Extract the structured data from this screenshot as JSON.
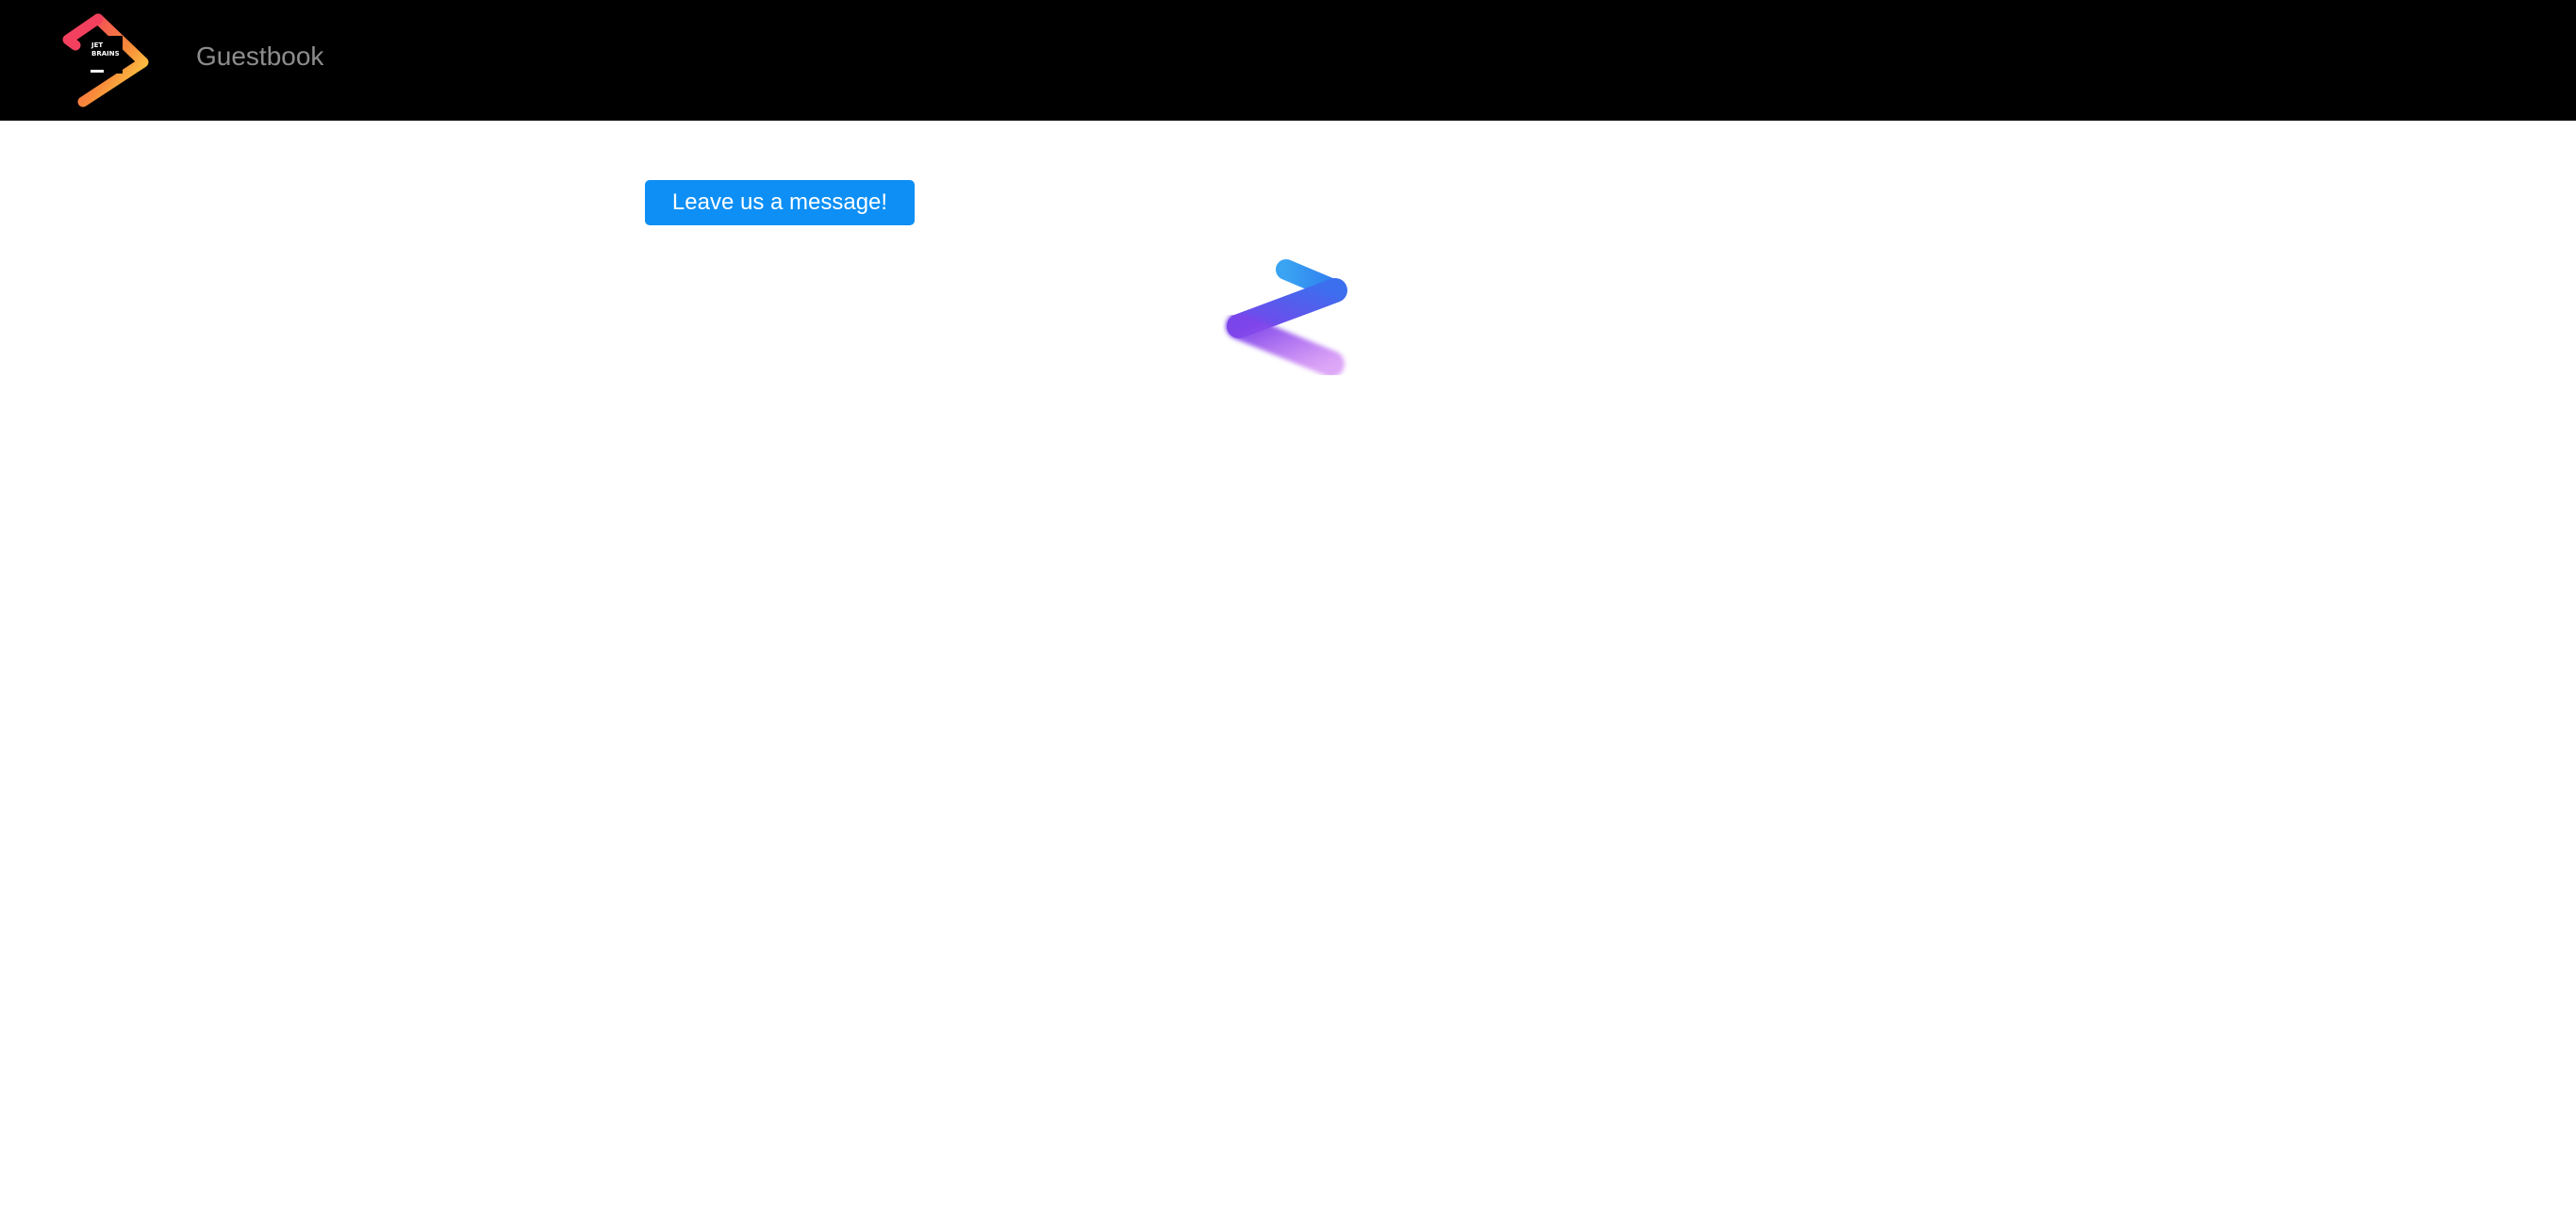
{
  "header": {
    "logo": {
      "icon": "jetbrains-logo-icon",
      "text_line1": "JET",
      "text_line2": "BRAINS"
    },
    "title": "Guestbook"
  },
  "main": {
    "leave_message_button": "Leave us a message!",
    "loading_indicator": {
      "icon": "kotlin-loading-spinner-icon"
    }
  },
  "colors": {
    "navbar_background": "#000000",
    "page_background": "#ffffff",
    "button_primary": "#0d8ff5",
    "logo_gradient": [
      "#f2405e",
      "#f88b3a",
      "#fde545"
    ],
    "spinner_gradient": [
      "#2d9cf3",
      "#7c43ea",
      "#b04be8"
    ]
  }
}
